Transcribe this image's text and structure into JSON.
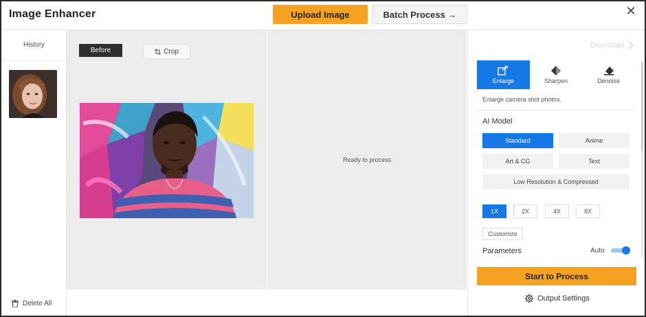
{
  "header": {
    "title": "Image Enhancer",
    "upload_label": "Upload Image",
    "batch_label": "Batch Process →",
    "close_glyph": "✕"
  },
  "history": {
    "title": "History",
    "delete_all": "Delete All"
  },
  "before": {
    "label": "Before",
    "crop_label": "Crop"
  },
  "after": {
    "status": "Ready to process"
  },
  "panel": {
    "download_label": "Download",
    "tabs": [
      {
        "label": "Enlarge",
        "icon": "enlarge-icon",
        "active": true
      },
      {
        "label": "Sharpen",
        "icon": "sharpen-icon",
        "active": false
      },
      {
        "label": "Denoise",
        "icon": "denoise-icon",
        "active": false
      }
    ],
    "description": "Enlarge camera shot photos.",
    "ai_model_label": "AI Model",
    "models": [
      {
        "label": "Standard",
        "selected": true
      },
      {
        "label": "Anime",
        "selected": false
      },
      {
        "label": "Art & CG",
        "selected": false
      },
      {
        "label": "Text",
        "selected": false
      },
      {
        "label": "Low Resolution & Compressed",
        "selected": false
      }
    ],
    "scales": [
      {
        "label": "1X",
        "selected": true
      },
      {
        "label": "2X",
        "selected": false
      },
      {
        "label": "4X",
        "selected": false
      },
      {
        "label": "8X",
        "selected": false
      }
    ],
    "customize_label": "Customize",
    "parameters_label": "Parameters",
    "auto_label": "Auto",
    "auto_enabled": true,
    "start_label": "Start to Process",
    "output_settings_label": "Output Settings"
  },
  "colors": {
    "accent_orange": "#f5a223",
    "accent_blue": "#1677e6"
  }
}
